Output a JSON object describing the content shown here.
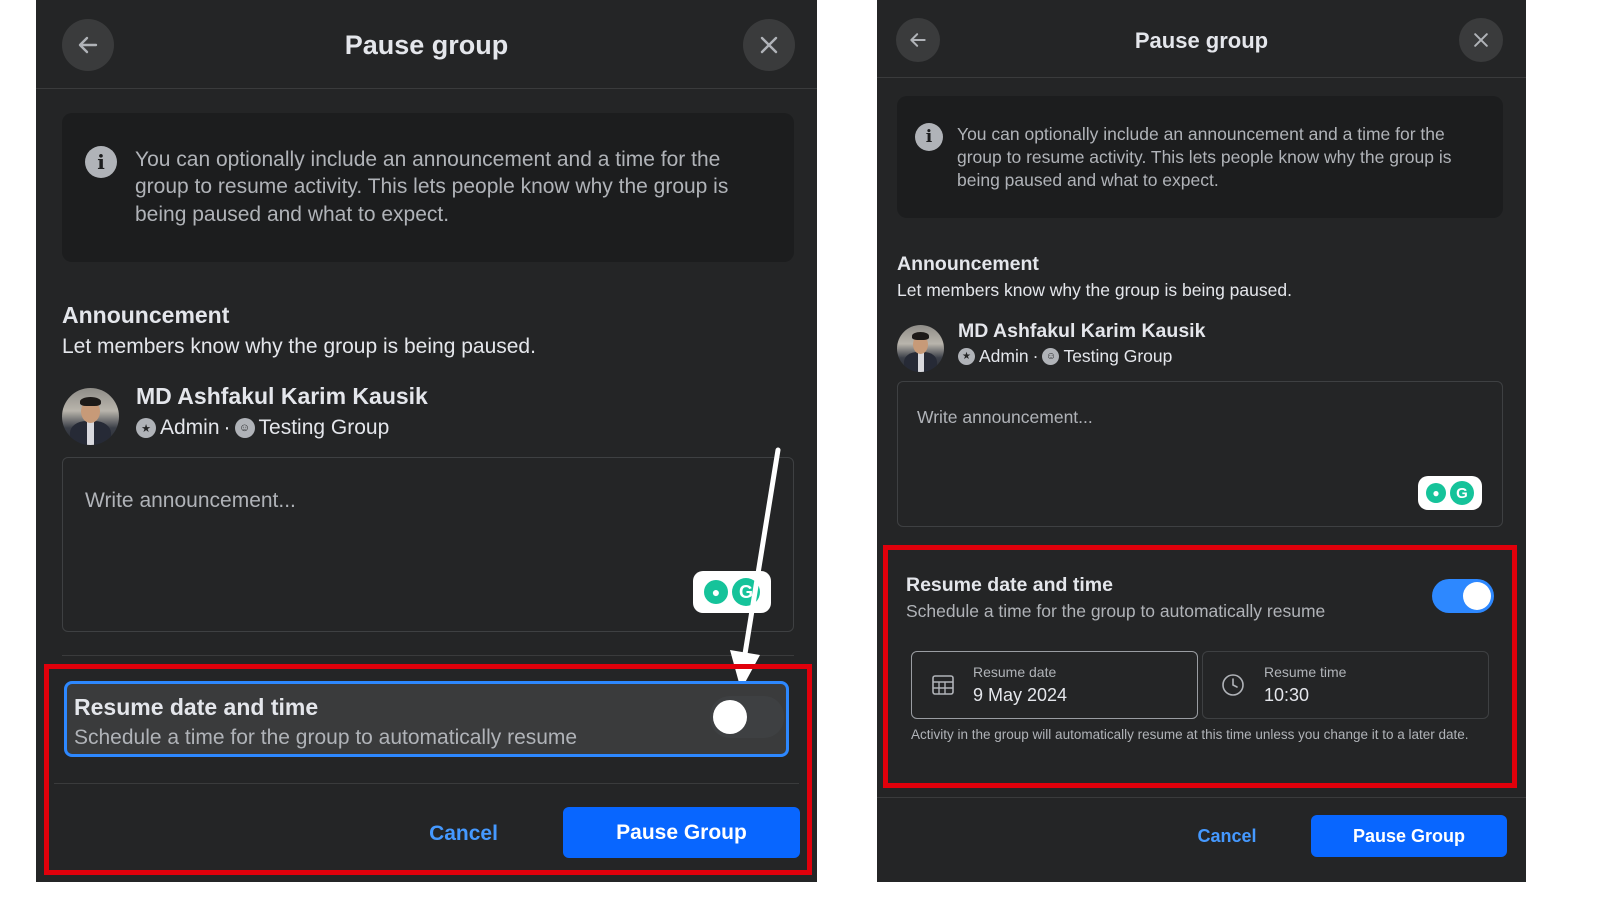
{
  "dialog": {
    "title": "Pause group",
    "info_text": "You can optionally include an announcement and a time for the group to resume activity. This lets people know why the group is being paused and what to expect.",
    "announcement_title": "Announcement",
    "announcement_subtitle": "Let members know why the group is being paused.",
    "user_name": "MD Ashfakul Karim Kausik",
    "user_role": "Admin",
    "separator": "·",
    "group_name": "Testing Group",
    "announcement_placeholder": "Write announcement...",
    "resume_title": "Resume date and time",
    "resume_subtitle": "Schedule a time for the group to automatically resume",
    "cancel_label": "Cancel",
    "pause_label": "Pause Group"
  },
  "left_state": {
    "toggle_on": false
  },
  "right_state": {
    "toggle_on": true,
    "resume_date_label": "Resume date",
    "resume_date_value": "9 May 2024",
    "resume_time_label": "Resume time",
    "resume_time_value": "10:30",
    "helper_text": "Activity in the group will automatically resume at this time unless you change it to a later date."
  },
  "icons": [
    "back-arrow-icon",
    "close-icon",
    "info-icon",
    "shield-icon",
    "group-icon",
    "calendar-icon",
    "clock-icon",
    "grammarly-icon"
  ],
  "colors": {
    "panel_bg": "#242526",
    "primary": "#0866ff",
    "highlight": "#e0000b",
    "toggle_on": "#2d88ff"
  }
}
